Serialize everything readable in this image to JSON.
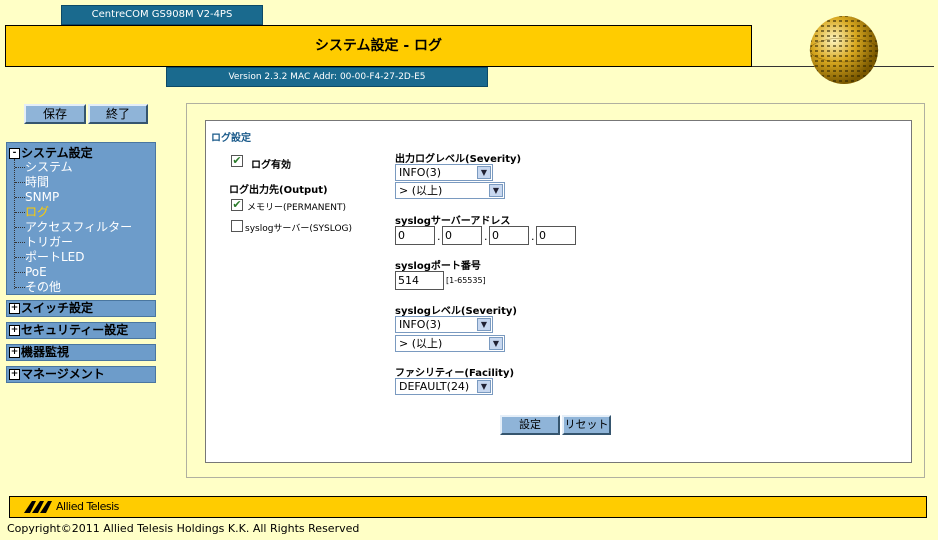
{
  "header": {
    "model": "CentreCOM GS908M V2-4PS",
    "title": "システム設定 - ログ",
    "version": "Version 2.3.2 MAC Addr: 00-00-F4-27-2D-E5"
  },
  "top_buttons": {
    "save": "保存",
    "end": "終了"
  },
  "sidebar": {
    "system_header": "システム設定",
    "system_items": [
      "システム",
      "時間",
      "SNMP",
      "ログ",
      "アクセスフィルター",
      "トリガー",
      "ポートLED",
      "PoE",
      "その他"
    ],
    "active_index": 3,
    "collapsed": [
      "スイッチ設定",
      "セキュリティー設定",
      "機器監視",
      "マネージメント"
    ],
    "expanded_symbol": "-",
    "collapsed_symbol": "+"
  },
  "main": {
    "section_title": "ログ設定",
    "log_enable": {
      "label": "ログ有効",
      "checked": true
    },
    "output_label": "ログ出力先(Output)",
    "memory": {
      "label": "メモリー(PERMANENT)",
      "checked": true
    },
    "syslog_server": {
      "label": "syslogサーバー(SYSLOG)",
      "checked": false
    },
    "output_level": {
      "label": "出力ログレベル(Severity)",
      "level": "INFO(3)",
      "op": "> (以上)"
    },
    "syslog_address": {
      "label": "syslogサーバーアドレス",
      "octets": [
        "0",
        "0",
        "0",
        "0"
      ],
      "dot": "."
    },
    "syslog_port": {
      "label": "syslogポート番号",
      "value": "514",
      "range": "[1-65535]"
    },
    "syslog_level": {
      "label": "syslogレベル(Severity)",
      "level": "INFO(3)",
      "op": "> (以上)"
    },
    "facility": {
      "label": "ファシリティー(Facility)",
      "value": "DEFAULT(24)"
    },
    "buttons": {
      "apply": "設定",
      "reset": "リセット"
    }
  },
  "footer": {
    "logo_text": "Allied Telesis",
    "copyright": "Copyright©2011 Allied Telesis Holdings K.K. All Rights Reserved"
  },
  "colors": {
    "accent": "#ffcc00",
    "nav_blue": "#6d9cca",
    "header_blue": "#1a6a8e",
    "background": "#ffffc6"
  }
}
